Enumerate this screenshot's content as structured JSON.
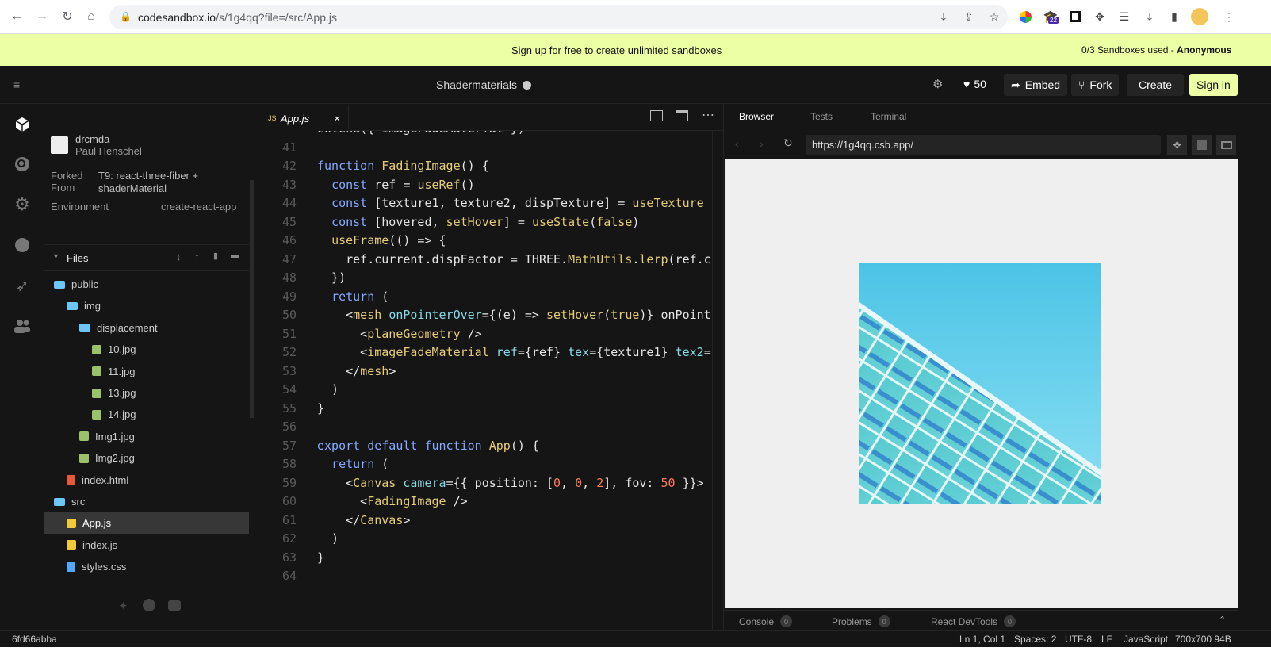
{
  "browser": {
    "url_host": "codesandbox.io",
    "url_path": "/s/1g4qq?file=/src/App.js",
    "extension_badge": "22"
  },
  "banner": {
    "message": "Sign up for free to create unlimited sandboxes",
    "usage": "0/3 Sandboxes used - ",
    "user": "Anonymous"
  },
  "header": {
    "title": "Shadermaterials",
    "likes": "50",
    "embed": "Embed",
    "fork": "Fork",
    "create": "Create",
    "signin": "Sign in"
  },
  "sidebar": {
    "author_handle": "drcmda",
    "author_name": "Paul Henschel",
    "forked_label": "Forked From",
    "forked_from_1": "T9: react-three-fiber +",
    "forked_from_2": "shaderMaterial",
    "env_label": "Environment",
    "env_value": "create-react-app",
    "files_label": "Files",
    "files": [
      {
        "name": "public",
        "type": "folder"
      },
      {
        "name": "img",
        "type": "folder"
      },
      {
        "name": "displacement",
        "type": "folder"
      },
      {
        "name": "10.jpg",
        "type": "image"
      },
      {
        "name": "11.jpg",
        "type": "image"
      },
      {
        "name": "13.jpg",
        "type": "image"
      },
      {
        "name": "14.jpg",
        "type": "image"
      },
      {
        "name": "Img1.jpg",
        "type": "image"
      },
      {
        "name": "Img2.jpg",
        "type": "image"
      },
      {
        "name": "index.html",
        "type": "html"
      },
      {
        "name": "src",
        "type": "folder"
      },
      {
        "name": "App.js",
        "type": "js"
      },
      {
        "name": "index.js",
        "type": "js"
      },
      {
        "name": "styles.css",
        "type": "css"
      }
    ]
  },
  "editor": {
    "tab_label": "App.js",
    "tab_lang": "JS",
    "lines": [
      {
        "n": "",
        "text": "extend({ ImageFadeMaterial })"
      },
      {
        "n": "41",
        "text": ""
      },
      {
        "n": "42",
        "text": "function FadingImage() {"
      },
      {
        "n": "43",
        "text": "  const ref = useRef()"
      },
      {
        "n": "44",
        "text": "  const [texture1, texture2, dispTexture] = useTexture"
      },
      {
        "n": "45",
        "text": "  const [hovered, setHover] = useState(false)"
      },
      {
        "n": "46",
        "text": "  useFrame(() => {"
      },
      {
        "n": "47",
        "text": "    ref.current.dispFactor = THREE.MathUtils.lerp(ref.c"
      },
      {
        "n": "48",
        "text": "  })"
      },
      {
        "n": "49",
        "text": "  return ("
      },
      {
        "n": "50",
        "text": "    <mesh onPointerOver={(e) => setHover(true)} onPoint"
      },
      {
        "n": "51",
        "text": "      <planeGeometry />"
      },
      {
        "n": "52",
        "text": "      <imageFadeMaterial ref={ref} tex={texture1} tex2="
      },
      {
        "n": "53",
        "text": "    </mesh>"
      },
      {
        "n": "54",
        "text": "  )"
      },
      {
        "n": "55",
        "text": "}"
      },
      {
        "n": "56",
        "text": ""
      },
      {
        "n": "57",
        "text": "export default function App() {"
      },
      {
        "n": "58",
        "text": "  return ("
      },
      {
        "n": "59",
        "text": "    <Canvas camera={{ position: [0, 0, 2], fov: 50 }}>"
      },
      {
        "n": "60",
        "text": "      <FadingImage />"
      },
      {
        "n": "61",
        "text": "    </Canvas>"
      },
      {
        "n": "62",
        "text": "  )"
      },
      {
        "n": "63",
        "text": "}"
      },
      {
        "n": "64",
        "text": ""
      }
    ]
  },
  "preview": {
    "tabs": [
      "Browser",
      "Tests",
      "Terminal"
    ],
    "address": "https://1g4qq.csb.app/",
    "bottom_tabs": [
      {
        "label": "Console",
        "count": "0"
      },
      {
        "label": "Problems",
        "count": "0"
      },
      {
        "label": "React DevTools",
        "count": "0"
      }
    ]
  },
  "status": {
    "commit": "6fd66abba",
    "position": "Ln 1, Col 1",
    "spaces": "Spaces: 2",
    "encoding": "UTF-8",
    "eol": "LF",
    "language": "JavaScript",
    "dimensions": "700x700 94B"
  },
  "colors": {
    "banner_bg": "#edffa5",
    "signin_bg": "#edffa5",
    "folder": "#6cc7f6",
    "js_icon": "#f0c93d",
    "html_icon": "#e55a3b",
    "css_icon": "#52a8ff",
    "image_icon": "#9bc26a"
  }
}
